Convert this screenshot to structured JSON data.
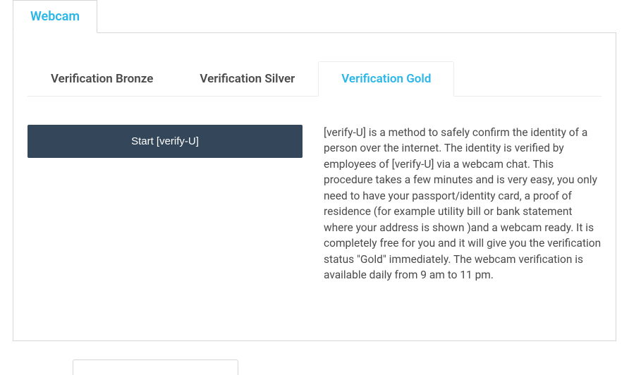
{
  "outer_tab": {
    "label": "Webcam"
  },
  "inner_tabs": {
    "bronze": {
      "label": "Verification Bronze"
    },
    "silver": {
      "label": "Verification Silver"
    },
    "gold": {
      "label": "Verification Gold"
    }
  },
  "content": {
    "start_button": "Start [verify-U]",
    "description": "[verify-U] is a method to safely confirm the identity of a person over the internet. The identity is verified by employees of [verify-U] via a webcam chat. This procedure takes a few minutes and is very easy, you only need to have your passport/identity card, a proof of residence (for example utility bill or bank statement where your address is shown )and a webcam ready. It is completely free for you and it will give you the verification status \"Gold\" immediately. The webcam verification is available daily from 9 am to 11 pm."
  }
}
